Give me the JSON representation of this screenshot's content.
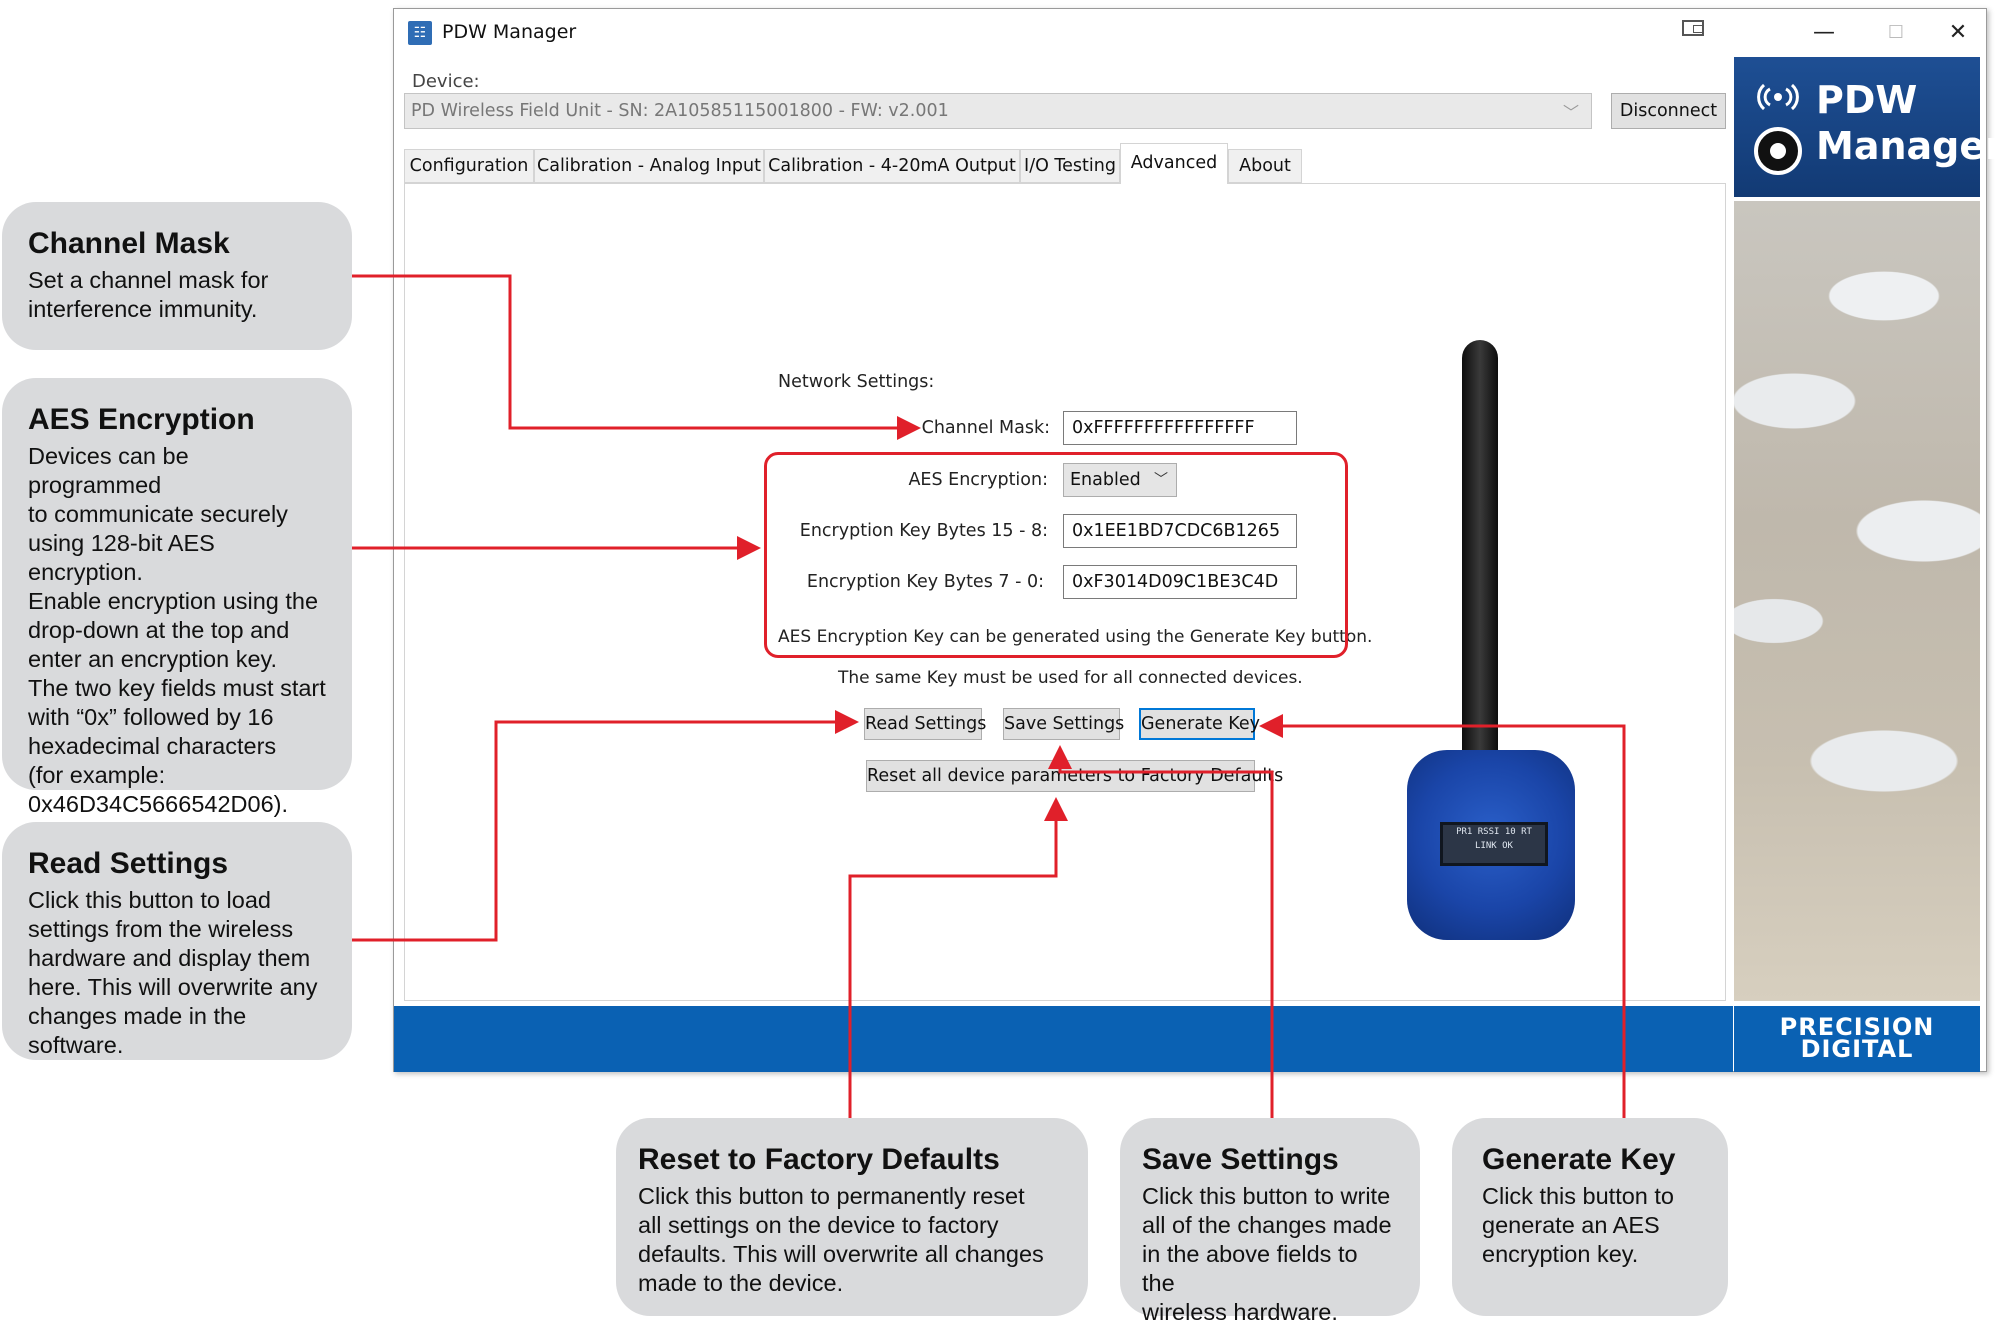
{
  "window": {
    "title": "PDW Manager",
    "minimize_glyph": "—",
    "maximize_glyph": "☐",
    "close_glyph": "✕"
  },
  "device": {
    "label": "Device:",
    "selected": "PD Wireless Field Unit - SN: 2A10585115001800 - FW: v2.001",
    "disconnect_label": "Disconnect"
  },
  "tabs": [
    {
      "label": "Configuration",
      "active": false
    },
    {
      "label": "Calibration - Analog Input",
      "active": false
    },
    {
      "label": "Calibration - 4-20mA Output",
      "active": false
    },
    {
      "label": "I/O Testing",
      "active": false
    },
    {
      "label": "Advanced",
      "active": true
    },
    {
      "label": "About",
      "active": false
    }
  ],
  "network": {
    "heading": "Network Settings:",
    "channel_mask_label": "Channel Mask:",
    "channel_mask_value": "0xFFFFFFFFFFFFFFFF",
    "aes_label": "AES Encryption:",
    "aes_value": "Enabled",
    "key_hi_label": "Encryption Key Bytes 15 - 8:",
    "key_hi_value": "0x1EE1BD7CDC6B1265",
    "key_lo_label": "Encryption Key Bytes 7 - 0:",
    "key_lo_value": "0xF3014D09C1BE3C4D",
    "note1": "AES Encryption Key can be generated using the Generate Key button.",
    "note2": "The same Key must be used for all connected devices.",
    "read_label": "Read Settings",
    "save_label": "Save Settings",
    "generate_label": "Generate Key",
    "reset_label": "Reset all device parameters to Factory Defaults"
  },
  "brand": {
    "product_name": "PDW Manager",
    "company_logo": "PRECISION DIGITAL",
    "device_screen": "PR1 RSSI 10 RT LINK OK"
  },
  "callouts": {
    "channel_mask": {
      "title": "Channel Mask",
      "body": "Set a channel mask for\ninterference immunity."
    },
    "aes": {
      "title": "AES Encryption",
      "body": "Devices can be programmed\nto communicate securely\nusing 128-bit AES encryption.\nEnable encryption using the\ndrop-down at the top and\nenter an encryption key.\nThe two key fields must start\nwith “0x” followed by 16\nhexadecimal characters\n(for example:\n0x46D34C5666542D06)."
    },
    "read": {
      "title": "Read Settings",
      "body": "Click this button to load\nsettings from the wireless\nhardware and display them\nhere. This will overwrite any\nchanges made in the\nsoftware."
    },
    "reset": {
      "title": "Reset to Factory Defaults",
      "body": "Click this button to permanently reset\nall settings on the device to factory\ndefaults. This will overwrite all changes\nmade to the device."
    },
    "save": {
      "title": "Save Settings",
      "body": "Click this button to write\nall of the changes made\nin the above fields to the\nwireless hardware."
    },
    "generate": {
      "title": "Generate Key",
      "body": "Click this button to\ngenerate an AES\nencryption key."
    }
  },
  "colors": {
    "annotation_red": "#e0202a",
    "callout_gray": "#d9dadc",
    "brand_blue": "#0a61b3"
  }
}
